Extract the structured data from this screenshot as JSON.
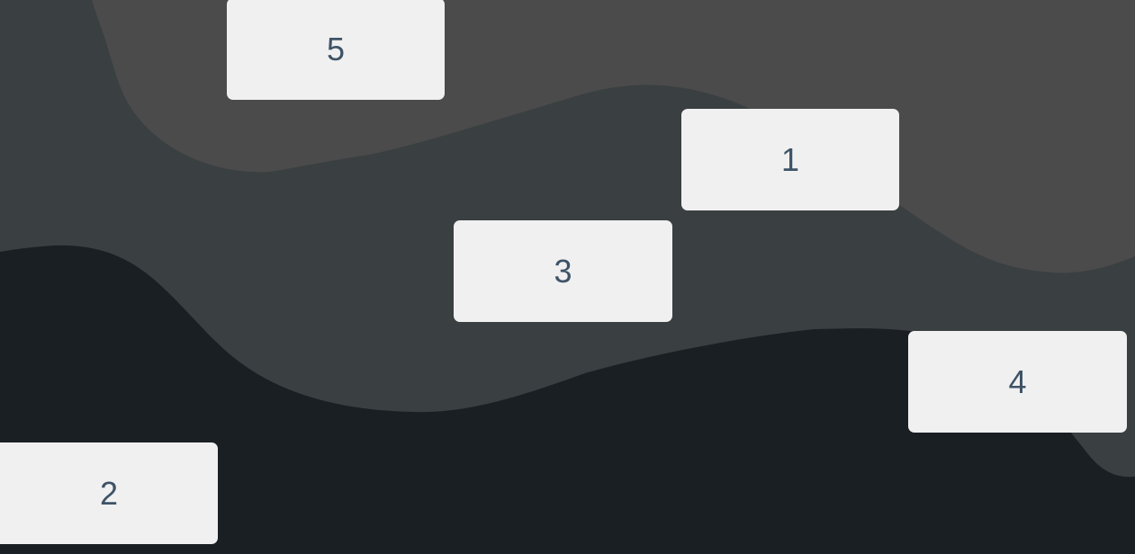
{
  "colors": {
    "background_dark": "#1a1f24",
    "wave_middle": "#3a3f41",
    "wave_top": "#4b4b4b",
    "tile_background": "#f0f0f0",
    "tile_text": "#3e5366"
  },
  "tiles": [
    {
      "label": "5"
    },
    {
      "label": "1"
    },
    {
      "label": "3"
    },
    {
      "label": "4"
    },
    {
      "label": "2"
    }
  ]
}
